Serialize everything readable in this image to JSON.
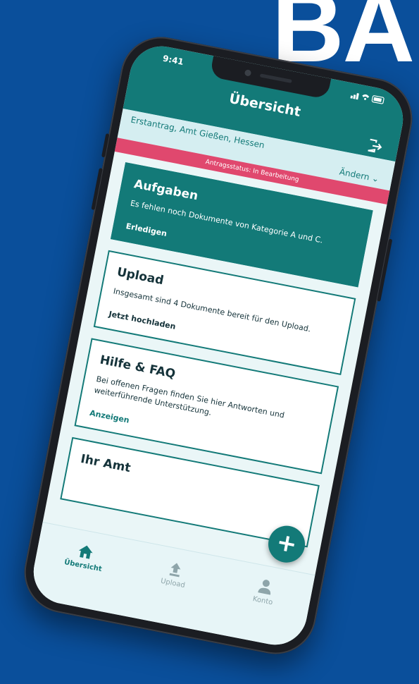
{
  "background": {
    "word": "BA",
    "color": "#0a4f9b"
  },
  "status_bar": {
    "time": "9:41"
  },
  "header": {
    "title": "Übersicht",
    "logout_icon": "logout-icon"
  },
  "subbar": {
    "location": "Erstantrag, Amt Gießen, Hessen",
    "change_label": "Ändern"
  },
  "status_banner": {
    "text": "Antragsstatus: In Bearbeitung",
    "color": "#e0486e"
  },
  "cards": [
    {
      "title": "Aufgaben",
      "text": "Es fehlen noch Dokumente von Kategorie A und C.",
      "action": "Erledigen"
    },
    {
      "title": "Upload",
      "text": "Insgesamt sind 4 Dokumente bereit für den Upload.",
      "action": "Jetzt hochladen"
    },
    {
      "title": "Hilfe & FAQ",
      "text": "Bei offenen Fragen finden Sie hier Antworten und weiterführende Unterstützung.",
      "action": "Anzeigen"
    },
    {
      "title": "Ihr Amt"
    }
  ],
  "fab": {
    "label": "+"
  },
  "tabbar": {
    "tabs": [
      {
        "label": "Übersicht",
        "icon": "home-icon",
        "active": true
      },
      {
        "label": "Upload",
        "icon": "upload-icon",
        "active": false
      },
      {
        "label": "Konto",
        "icon": "user-icon",
        "active": false
      }
    ]
  },
  "colors": {
    "accent": "#137a78",
    "banner": "#e0486e",
    "light": "#d5eef1"
  }
}
